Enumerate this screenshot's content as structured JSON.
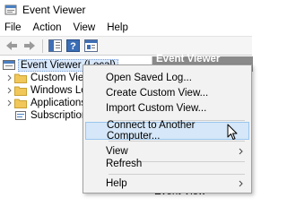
{
  "window": {
    "title": "Event Viewer"
  },
  "menu": [
    "File",
    "Action",
    "View",
    "Help"
  ],
  "toolbar": {
    "buttons": [
      "back-arrow-icon",
      "forward-arrow-icon",
      "show-hide-tree-icon",
      "help-icon",
      "properties-icon"
    ]
  },
  "tree": {
    "root": "Event Viewer (Local)",
    "children": [
      {
        "label": "Custom Views",
        "expandable": true
      },
      {
        "label": "Windows Logs",
        "expandable": true
      },
      {
        "label": "Applications and",
        "expandable": true
      },
      {
        "label": "Subscriptions",
        "expandable": false
      }
    ]
  },
  "actions_pane": {
    "header": "Event Viewer (Local)",
    "bottom_text": "Event View"
  },
  "context_menu": {
    "items": [
      {
        "label": "Open Saved Log...",
        "submenu": false,
        "highlighted": false
      },
      {
        "label": "Create Custom View...",
        "submenu": false,
        "highlighted": false
      },
      {
        "label": "Import Custom View...",
        "submenu": false,
        "highlighted": false
      },
      {
        "label": "Connect to Another Computer...",
        "submenu": false,
        "highlighted": true
      },
      {
        "label": "View",
        "submenu": true,
        "highlighted": false
      },
      {
        "label": "Refresh",
        "submenu": false,
        "highlighted": false
      },
      {
        "label": "Help",
        "submenu": true,
        "highlighted": false
      }
    ]
  },
  "colors": {
    "selection": "#d9e8fb",
    "highlight": "#d5e7f8",
    "header": "#8a8a8a"
  }
}
